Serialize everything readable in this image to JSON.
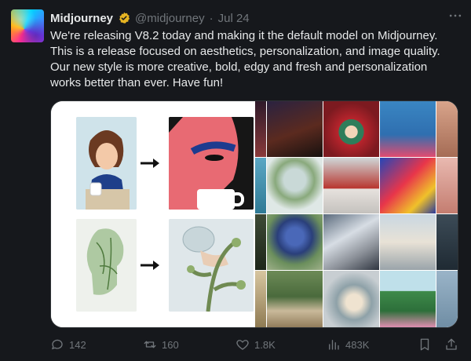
{
  "tweet": {
    "author_name": "Midjourney",
    "handle": "@midjourney",
    "separator": "·",
    "date": "Jul 24",
    "text": "We're releasing V8.2 today and making it the default model on Midjourney. This is a release focused on aesthetics, personalization, and image quality. Our new style is more creative, bold, edgy and fresh and personalization works better than ever. Have fun!"
  },
  "actions": {
    "replies": "142",
    "reposts": "160",
    "likes": "1.8K",
    "views": "483K"
  },
  "colors": {
    "background": "#16181c",
    "text": "#e7e9ea",
    "muted": "#71767b",
    "verified": "#e6b422"
  }
}
